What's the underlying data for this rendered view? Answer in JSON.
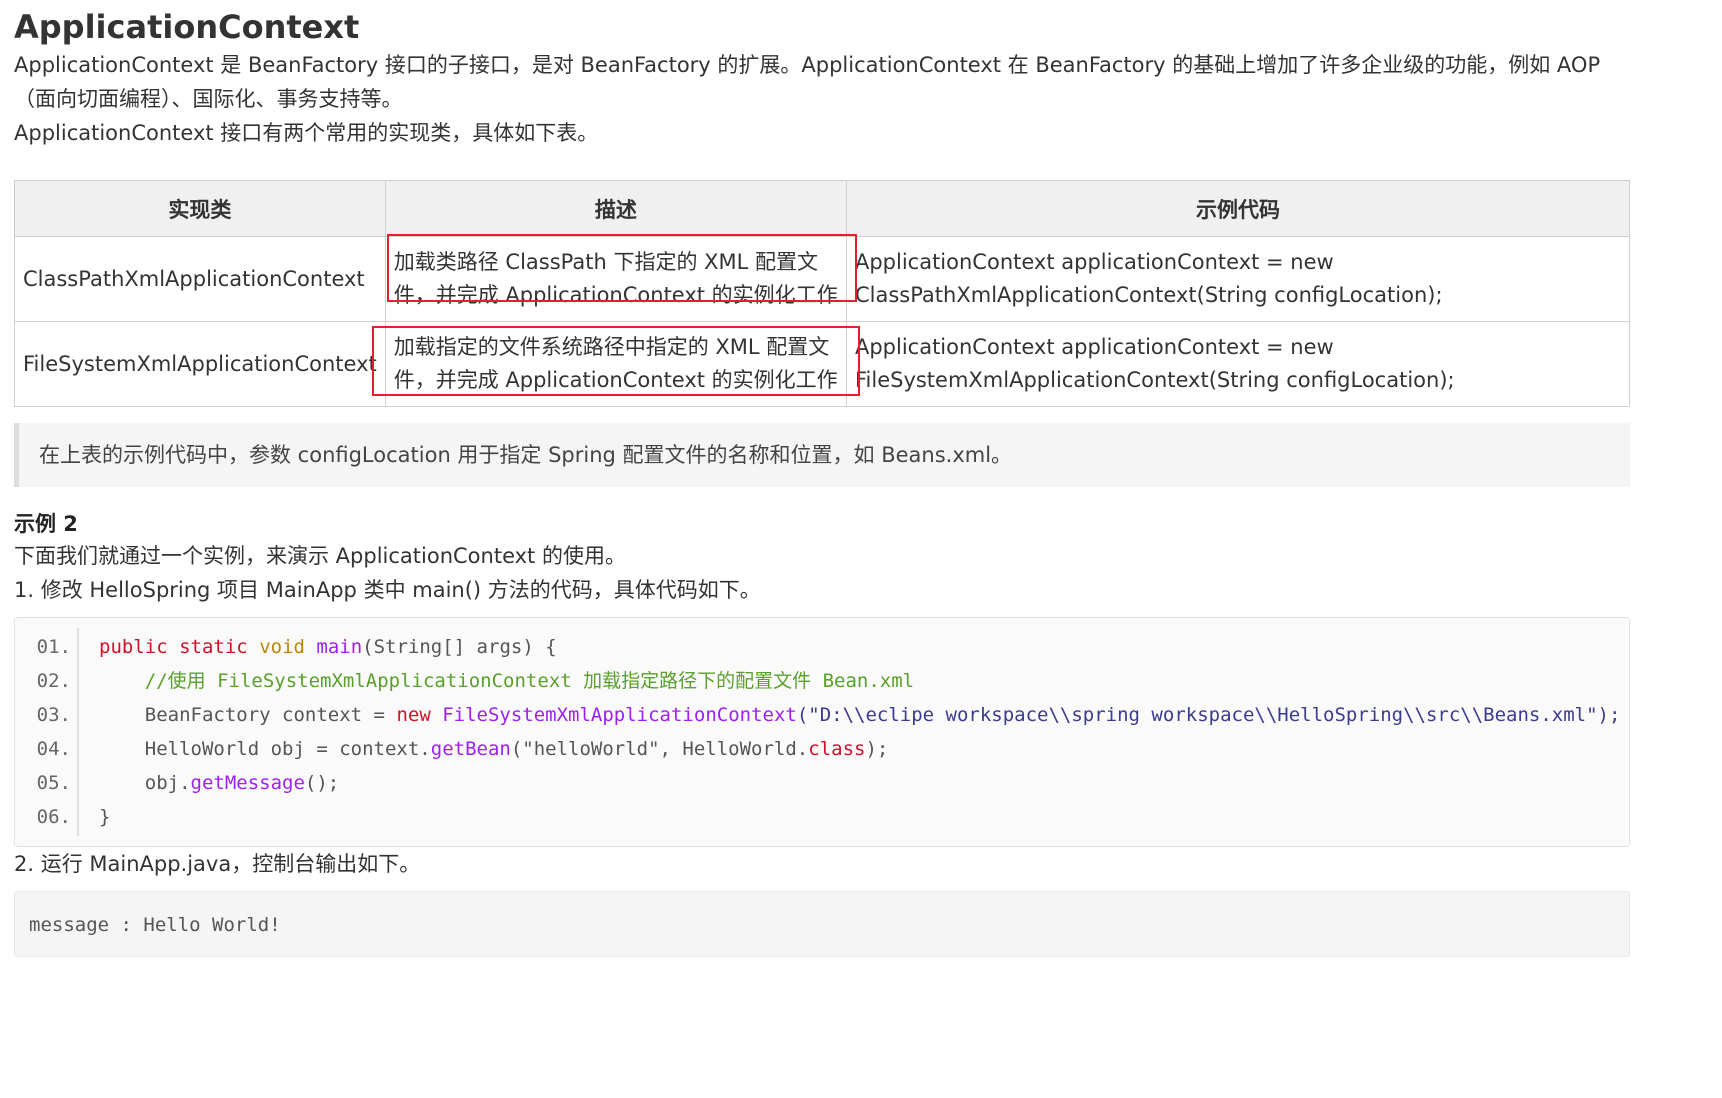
{
  "title": "ApplicationContext",
  "intro": "ApplicationContext 是 BeanFactory 接口的子接口，是对 BeanFactory 的扩展。ApplicationContext 在 BeanFactory 的基础上增加了许多企业级的功能，例如 AOP（面向切面编程）、国际化、事务支持等。",
  "intro2": "ApplicationContext 接口有两个常用的实现类，具体如下表。",
  "table": {
    "headers": [
      "实现类",
      "描述",
      "示例代码"
    ],
    "rows": [
      {
        "cls": "ClassPathXmlApplicationContext",
        "desc": "加载类路径 ClassPath 下指定的 XML 配置文件，并完成 ApplicationContext 的实例化工作",
        "code_l1": "ApplicationContext applicationContext = new",
        "code_l2": "ClassPathXmlApplicationContext(String configLocation);"
      },
      {
        "cls": "FileSystemXmlApplicationContext",
        "desc": "加载指定的文件系统路径中指定的 XML 配置文件，并完成 ApplicationContext 的实例化工作",
        "code_l1": "ApplicationContext applicationContext = new",
        "code_l2": "FileSystemXmlApplicationContext(String configLocation);"
      }
    ]
  },
  "note": "在上表的示例代码中，参数 configLocation 用于指定 Spring 配置文件的名称和位置，如 Beans.xml。",
  "example_heading": "示例 2",
  "example_intro": "下面我们就通过一个实例，来演示 ApplicationContext 的使用。",
  "step1": "1. 修改 HelloSpring 项目 MainApp 类中 main() 方法的代码，具体代码如下。",
  "code": {
    "line_numbers": [
      "01.",
      "02.",
      "03.",
      "04.",
      "05.",
      "06."
    ],
    "l1": {
      "kw1": "public",
      "kw2": "static",
      "kw3": "void",
      "fn": "main",
      "rest": "(String[] args) {"
    },
    "l2": {
      "comment": "//使用 FileSystemXmlApplicationContext 加载指定路径下的配置文件 Bean.xml"
    },
    "l3": {
      "a": "BeanFactory context = ",
      "kw": "new",
      "fn": "FileSystemXmlApplicationContext",
      "str": "(\"D:\\\\eclipe workspace\\\\spring workspace\\\\HelloSpring\\\\src\\\\Beans.xml\");"
    },
    "l4": {
      "a": "HelloWorld obj = context.",
      "fn": "getBean",
      "b": "(\"helloWorld\", HelloWorld.",
      "kw": "class",
      "c": ");"
    },
    "l5": {
      "a": "obj.",
      "fn": "getMessage",
      "b": "();"
    },
    "l6": {
      "a": "}"
    }
  },
  "step2": "2. 运行 MainApp.java，控制台输出如下。",
  "output": "message : Hello World!",
  "colors": {
    "highlight_box": "#e0202a",
    "keyword": "#d0102a",
    "comment": "#5aa02c",
    "function": "#a020f0"
  }
}
